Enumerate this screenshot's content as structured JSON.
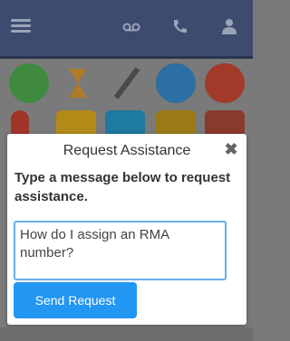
{
  "header": {
    "icons": [
      "hamburger-icon",
      "voicemail-icon",
      "phone-icon",
      "user-icon"
    ]
  },
  "colors": {
    "header_bg": "#3c4b6e",
    "send_button_bg": "#2196f3",
    "textarea_border": "#66aee8"
  },
  "modal": {
    "title": "Request Assistance",
    "close_icon": "close-icon",
    "prompt": "Type a message below to request assistance.",
    "textarea_value": "How do I assign an RMA number?",
    "send_label": "Send Request"
  }
}
